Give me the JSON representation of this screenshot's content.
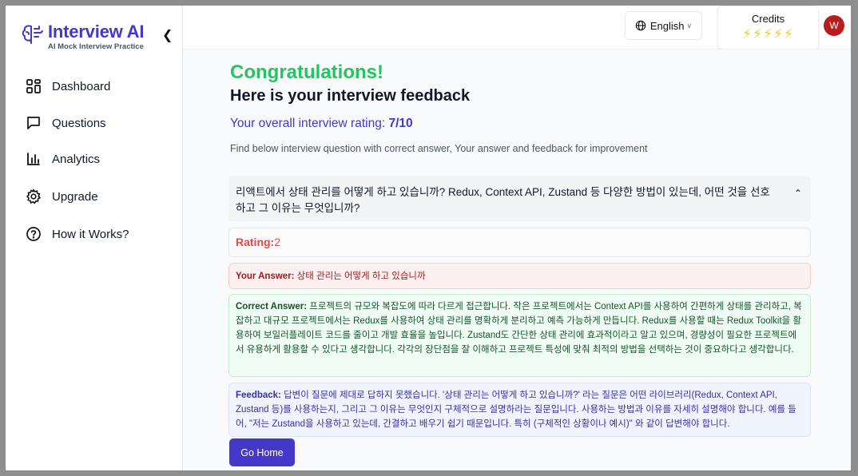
{
  "brand": {
    "title": "Interview AI",
    "subtitle": "AI Mock Interview Practice",
    "collapse_icon": "chevron-left-icon"
  },
  "sidebar": {
    "items": [
      {
        "label": "Dashboard",
        "icon": "dashboard-icon"
      },
      {
        "label": "Questions",
        "icon": "message-square-icon"
      },
      {
        "label": "Analytics",
        "icon": "bar-chart-icon"
      },
      {
        "label": "Upgrade",
        "icon": "gear-icon"
      },
      {
        "label": "How it Works?",
        "icon": "help-circle-icon"
      }
    ]
  },
  "header": {
    "language": "English",
    "credits_label": "Credits",
    "credits_icons": "⚡⚡⚡⚡⚡",
    "avatar_initial": "W"
  },
  "feedback": {
    "congrats": "Congratulations!",
    "heading": "Here is your interview feedback",
    "rating_prefix": "Your overall interview rating: ",
    "rating_value": "7/10",
    "description": "Find below interview question with correct answer, Your answer and feedback for improvement",
    "question": "리액트에서 상태 관리를 어떻게 하고 있습니까? Redux, Context API, Zustand 등 다양한 방법이 있는데, 어떤 것을 선호하고 그 이유는 무엇입니까?",
    "rating_label": "Rating:",
    "rating_score": "2",
    "answer_label": "Your Answer:",
    "answer_text": " 상태 관리는 어떻게 하고 있습니까",
    "correct_label": "Correct Answer:",
    "correct_text": " 프로젝트의 규모와 복잡도에 따라 다르게 접근합니다. 작은 프로젝트에서는 Context API를 사용하여 간편하게 상태를 관리하고, 복잡하고 대규모 프로젝트에서는 Redux를 사용하여 상태 관리를 명확하게 분리하고 예측 가능하게 만듭니다. Redux를 사용할 때는 Redux Toolkit을 활용하여 보일러플레이트 코드를 줄이고 개발 효율을 높입니다. Zustand도 간단한 상태 관리에 효과적이라고 알고 있으며, 경량성이 필요한 프로젝트에서 유용하게 활용할 수 있다고 생각합니다. 각각의 장단점을 잘 이해하고 프로젝트 특성에 맞춰 최적의 방법을 선택하는 것이 중요하다고 생각합니다.",
    "feedback_label": "Feedback:",
    "feedback_text": " 답변이 질문에 제대로 답하지 못했습니다. '상태 관리는 어떻게 하고 있습니까?' 라는 질문은 어떤 라이브러리(Redux, Context API, Zustand 등)를 사용하는지, 그리고 그 이유는 무엇인지 구체적으로 설명하라는 질문입니다. 사용하는 방법과 이유를 자세히 설명해야 합니다. 예를 들어, \"저는 Zustand을 사용하고 있는데, 간결하고 배우기 쉽기 때문입니다. 특히 (구체적인 상황이나 예시)\" 와 같이 답변해야 합니다.",
    "go_home": "Go Home"
  },
  "colors": {
    "brand": "#4338ca",
    "success": "#22c55e",
    "danger": "#ef4444",
    "credits": "#facc15",
    "avatar": "#b91c1c"
  }
}
